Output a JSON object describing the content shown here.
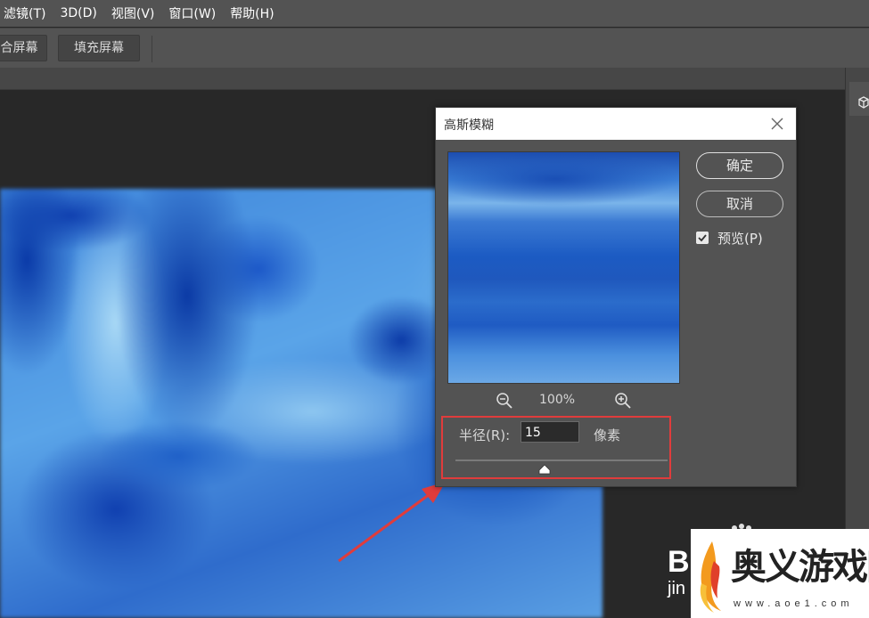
{
  "menu": [
    "滤镜(T)",
    "3D(D)",
    "视图(V)",
    "窗口(W)",
    "帮助(H)"
  ],
  "options_bar": {
    "fit_screen_label": "合屏幕",
    "fill_screen_label": "填充屏幕"
  },
  "dialog": {
    "title": "高斯模糊",
    "ok_label": "确定",
    "cancel_label": "取消",
    "preview_label": "预览(P)",
    "preview_checked": true,
    "zoom_level": "100%",
    "radius_label": "半径(R):",
    "radius_value": "15",
    "radius_unit": "像素",
    "radius_slider_fraction": 0.42
  },
  "watermark": {
    "baidu_letters": "B",
    "baidu_sub": "jin",
    "site_name": "奥义游戏网",
    "site_url": "www.aoe1.com"
  },
  "colors": {
    "highlight": "#e03c3c",
    "arrow": "#e03c3c",
    "panel": "#535353",
    "canvas_bg": "#282828"
  }
}
